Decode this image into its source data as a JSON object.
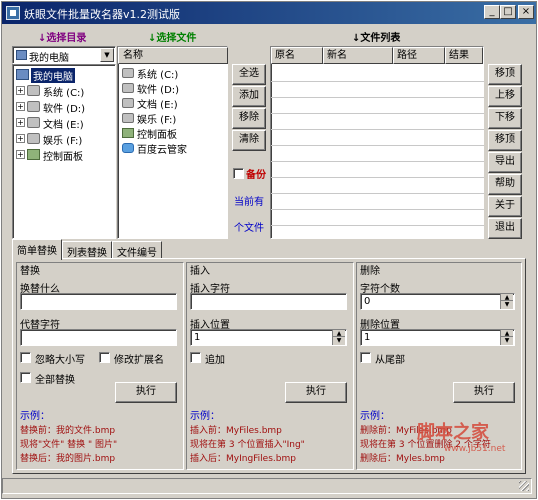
{
  "window": {
    "title": "妖眼文件批量改名器v1.2测试版",
    "min_glyph": "_",
    "max_glyph": "□",
    "close_glyph": "×"
  },
  "dirs": {
    "header": "↓选择目录",
    "drive_value": "我的电脑",
    "tree": [
      {
        "label": "我的电脑",
        "selected": true
      },
      {
        "label": "系统 (C:)",
        "expander": "+"
      },
      {
        "label": "软件 (D:)",
        "expander": "+"
      },
      {
        "label": "文档 (E:)",
        "expander": "+"
      },
      {
        "label": "娱乐 (F:)",
        "expander": "+"
      },
      {
        "label": "控制面板",
        "expander": "+"
      }
    ]
  },
  "files": {
    "header": "↓选择文件",
    "col_name": "名称",
    "items": [
      {
        "label": "系统 (C:)"
      },
      {
        "label": "软件 (D:)"
      },
      {
        "label": "文档 (E:)"
      },
      {
        "label": "娱乐 (F:)"
      },
      {
        "label": "控制面板"
      },
      {
        "label": "百度云管家"
      }
    ]
  },
  "actions": {
    "select_all": "全选",
    "add": "添加",
    "remove": "移除",
    "clear": "清除",
    "backup_label": "备份",
    "current_has": "当前有",
    "file_count_suffix": "个文件"
  },
  "filelist": {
    "header": "↓文件列表",
    "columns": [
      "原名",
      "新名",
      "路径",
      "结果"
    ]
  },
  "side_buttons": {
    "move_top": "移顶",
    "move_up": "上移",
    "move_down": "下移",
    "move_bottom": "移顶",
    "export": "导出",
    "help": "帮助",
    "about": "关于",
    "exit": "退出"
  },
  "tabs": {
    "simple": "简单替换",
    "list": "列表替换",
    "numbering": "文件编号"
  },
  "replace": {
    "title": "替换",
    "find_label": "换替什么",
    "replace_label": "代替字符",
    "ignore_case": "忽略大小写",
    "modify_ext": "修改扩展名",
    "replace_all": "全部替换",
    "run": "执行",
    "example_title": "示例：",
    "ex1": "替换前：我的文件.bmp",
    "ex2": "现将\"文件\" 替换 \" 图片\"",
    "ex3": "替换后：我的图片.bmp"
  },
  "insert": {
    "title": "插入",
    "chars_label": "插入字符",
    "pos_label": "插入位置",
    "pos_value": "1",
    "append": "追加",
    "run": "执行",
    "example_title": "示例：",
    "ex1": "插入前：MyFiles.bmp",
    "ex2": "现将在第 3 个位置插入\"Ing\"",
    "ex3": "插入后：MyIngFiles.bmp"
  },
  "delete": {
    "title": "删除",
    "count_label": "字符个数",
    "count_value": "0",
    "pos_label": "删除位置",
    "pos_value": "1",
    "from_end": "从尾部",
    "run": "执行",
    "example_title": "示例：",
    "ex1": "删除前：MyFiles.bmp",
    "ex2": "现将在第 3 个位置删除 2 个字符",
    "ex3": "删除后：Myles.bmp"
  },
  "watermark": {
    "text": "脚本之家",
    "sub": "www.jb51.net"
  }
}
